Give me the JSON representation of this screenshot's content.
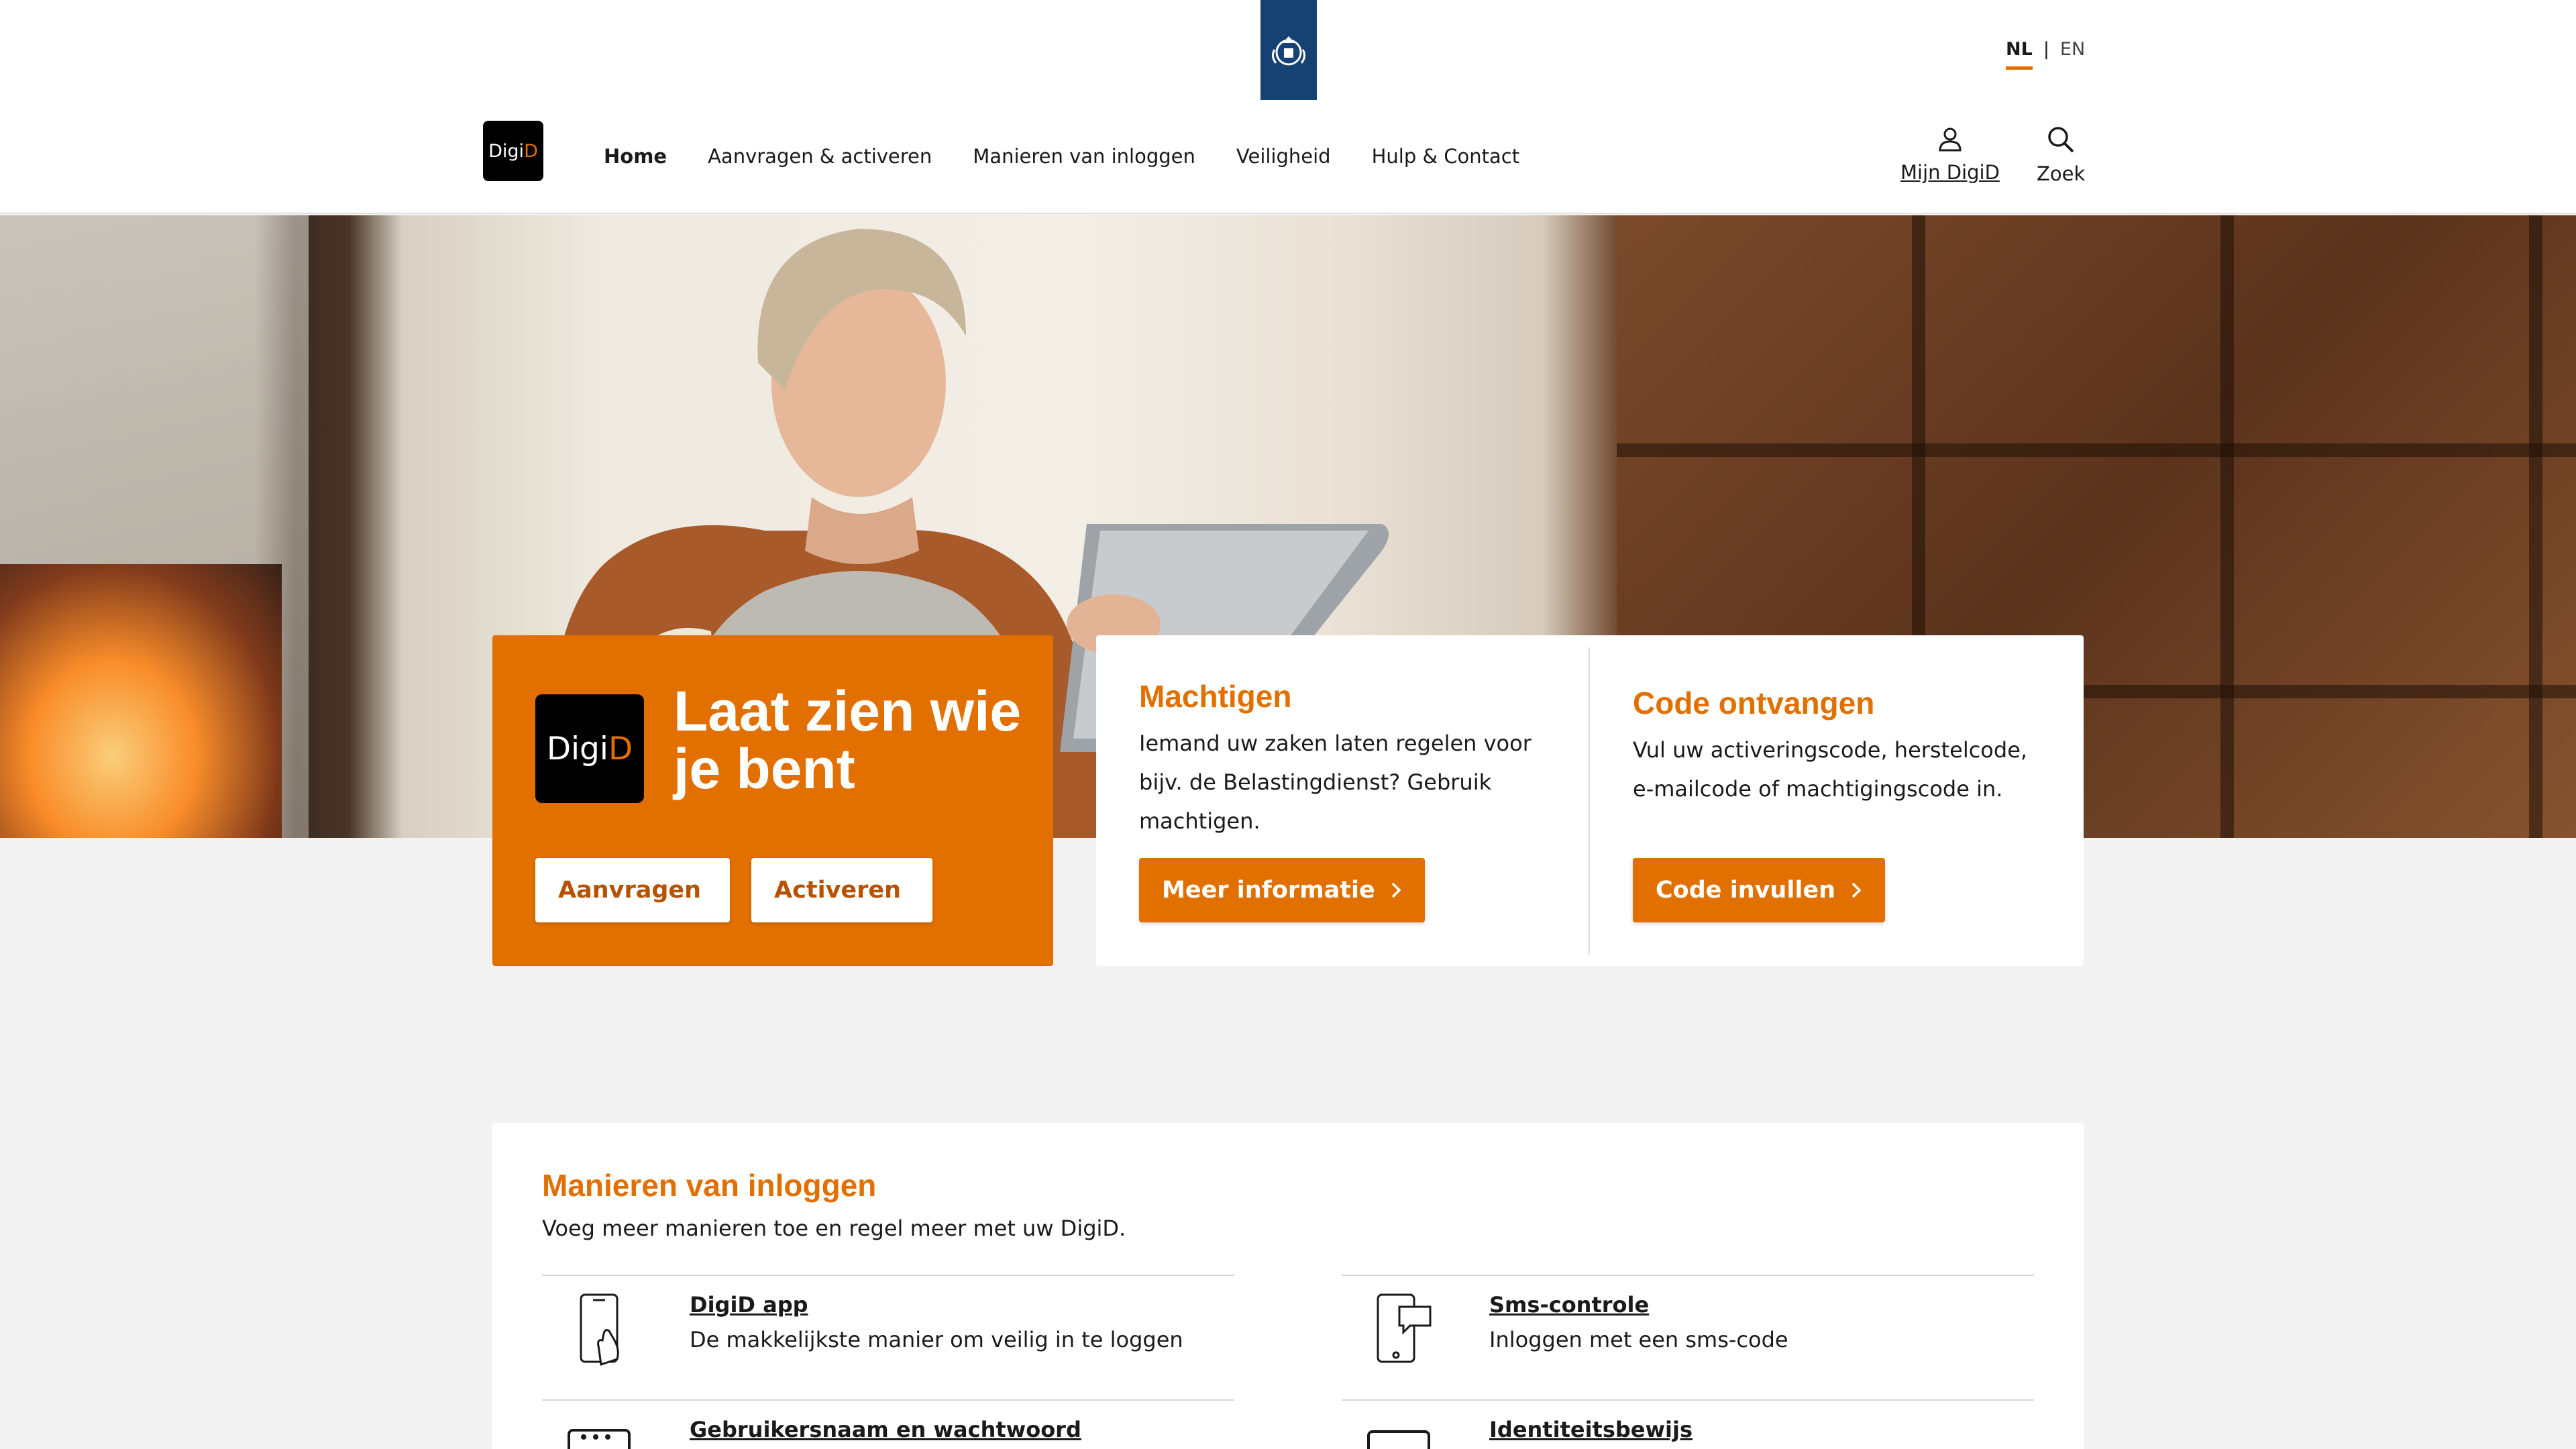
{
  "header": {
    "languages": {
      "nl": "NL",
      "separator": "|",
      "en": "EN",
      "active": "NL"
    },
    "logo_text": {
      "prefix": "Digi",
      "suffix": "D"
    },
    "nav": [
      "Home",
      "Aanvragen & activeren",
      "Manieren van inloggen",
      "Veiligheid",
      "Hulp & Contact"
    ],
    "nav_active": "Home",
    "account_label": "Mijn DigiD",
    "search_label": "Zoek",
    "icons": {
      "account": "user-icon",
      "search": "search-icon",
      "crest": "coat-of-arms-icon"
    }
  },
  "hero": {
    "logo_text": {
      "prefix": "Digi",
      "suffix": "D"
    },
    "heading": "Laat zien wie je bent",
    "buttons": {
      "request": "Aanvragen",
      "activate": "Activeren"
    }
  },
  "cards": {
    "authorize": {
      "title": "Machtigen",
      "text": "Iemand uw zaken laten regelen voor bijv. de Belastingdienst? Gebruik machtigen.",
      "button": "Meer informatie"
    },
    "code": {
      "title": "Code ontvangen",
      "text": "Vul uw activeringscode, herstelcode, e-mailcode of machtigingscode in.",
      "button": "Code invullen"
    }
  },
  "login_methods": {
    "title": "Manieren van inloggen",
    "subtitle": "Voeg meer manieren toe en regel meer met uw DigiD.",
    "items": [
      {
        "title": "DigiD app",
        "desc": "De makkelijkste manier om veilig in te loggen",
        "icon": "phone-tap-icon"
      },
      {
        "title": "Sms-controle",
        "desc": "Inloggen met een sms-code",
        "icon": "phone-message-icon"
      },
      {
        "title": "Gebruikersnaam en wachtwoord",
        "desc": "",
        "icon": "password-icon"
      },
      {
        "title": "Identiteitsbewijs",
        "desc": "",
        "icon": "id-card-icon"
      }
    ]
  },
  "colors": {
    "brand_orange": "#e17000",
    "crest_blue": "#154273",
    "dark_text": "#1a1a1a",
    "background": "#f3f3f3"
  }
}
